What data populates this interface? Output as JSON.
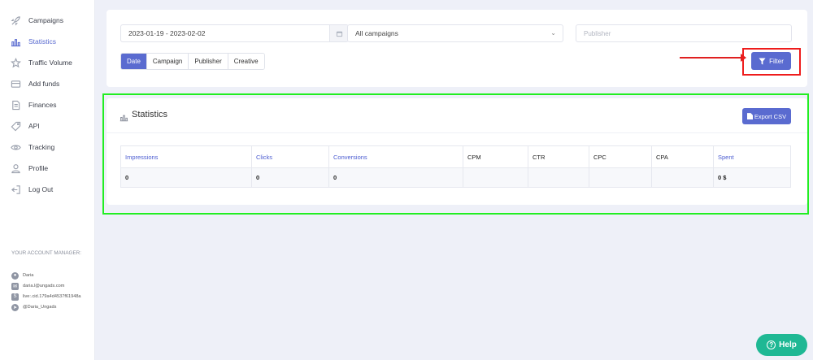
{
  "sidebar": {
    "items": [
      {
        "label": "Campaigns",
        "icon": "rocket-icon"
      },
      {
        "label": "Statistics",
        "icon": "bar-chart-icon",
        "active": true
      },
      {
        "label": "Traffic Volume",
        "icon": "star-icon"
      },
      {
        "label": "Add funds",
        "icon": "credit-card-icon"
      },
      {
        "label": "Finances",
        "icon": "document-icon"
      },
      {
        "label": "API",
        "icon": "tag-icon"
      },
      {
        "label": "Tracking",
        "icon": "eye-icon"
      },
      {
        "label": "Profile",
        "icon": "user-icon"
      },
      {
        "label": "Log Out",
        "icon": "logout-icon"
      }
    ],
    "account_manager": {
      "title": "YOUR ACCOUNT MANAGER:",
      "name": "Daria",
      "email": "daria.l@ungads.com",
      "skype": "live:.cid.179a4d4537f61948a",
      "telegram": "@Daria_Ungads"
    }
  },
  "filters": {
    "date_range": "2023-01-19 - 2023-02-02",
    "campaign_select": "All campaigns",
    "publisher_placeholder": "Publisher",
    "publisher_value": "",
    "tabs": [
      "Date",
      "Campaign",
      "Publisher",
      "Creative"
    ],
    "active_tab": "Date",
    "filter_button": "Filter"
  },
  "stats": {
    "title": "Statistics",
    "export_button": "Export CSV",
    "columns": [
      "Impressions",
      "Clicks",
      "Conversions",
      "CPM",
      "CTR",
      "CPC",
      "CPA",
      "Spent"
    ],
    "rows": [
      [
        "0",
        "0",
        "0",
        "",
        "",
        "",
        "",
        "0 $"
      ]
    ]
  },
  "help_button": "Help",
  "colors": {
    "accent": "#5a6bd0",
    "help": "#1fb894",
    "highlight_red": "#ee1c1c",
    "highlight_green": "#22ee22"
  }
}
